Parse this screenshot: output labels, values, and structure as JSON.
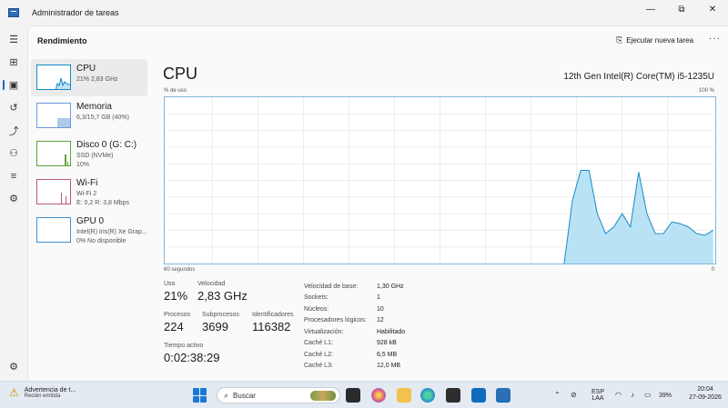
{
  "window": {
    "title": "Administrador de tareas",
    "controls": {
      "minimize": "—",
      "maximize": "⧉",
      "close": "✕"
    }
  },
  "header": {
    "page_title": "Rendimiento",
    "run_task_label": "Ejecutar nueva tarea",
    "more": "···"
  },
  "nav": {
    "items": [
      {
        "icon": "hamburger-icon",
        "glyph": "☰"
      },
      {
        "icon": "processes-icon",
        "glyph": "⊞"
      },
      {
        "icon": "performance-icon",
        "glyph": "▣",
        "active": true
      },
      {
        "icon": "app-history-icon",
        "glyph": "↺"
      },
      {
        "icon": "startup-apps-icon",
        "glyph": "⤴"
      },
      {
        "icon": "users-icon",
        "glyph": "⚇"
      },
      {
        "icon": "details-icon",
        "glyph": "≡"
      },
      {
        "icon": "services-icon",
        "glyph": "⚙"
      }
    ],
    "settings_glyph": "⚙"
  },
  "perf_list": [
    {
      "name": "CPU",
      "lines": [
        "21% 2,83 GHz"
      ],
      "selected": true,
      "color": "#1589c8"
    },
    {
      "name": "Memoria",
      "lines": [
        "6,3/15,7 GB (40%)"
      ],
      "color": "#6b9bd8"
    },
    {
      "name": "Disco 0 (G: C:)",
      "lines": [
        "SSD (NVMe)",
        "10%"
      ],
      "color": "#5ea43a"
    },
    {
      "name": "Wi-Fi",
      "lines": [
        "Wi-Fi 2",
        "E: 0,2 R: 3,8 Mbps"
      ],
      "color": "#b8587a"
    },
    {
      "name": "GPU 0",
      "lines": [
        "Intel(R) Iris(R) Xe Grap...",
        "0% No disponible"
      ],
      "color": "#3f8fd0"
    }
  ],
  "cpu": {
    "title": "CPU",
    "model": "12th Gen Intel(R) Core(TM) i5-1235U",
    "axis_y_label": "% de uso",
    "axis_y_max": "100 %",
    "axis_x_label": "60 segundos",
    "axis_x_min": "0",
    "graph_color": "#1589c8",
    "graph_fill": "#b9e3f5",
    "usage_series": [
      0,
      0,
      0,
      0,
      0,
      0,
      0,
      0,
      0,
      0,
      0,
      0,
      0,
      0,
      0,
      0,
      0,
      0,
      0,
      0,
      0,
      0,
      0,
      0,
      0,
      0,
      0,
      0,
      0,
      0,
      0,
      0,
      0,
      0,
      0,
      0,
      0,
      0,
      0,
      0,
      0,
      0,
      0,
      0,
      0,
      0,
      0,
      0,
      0,
      38,
      56,
      56,
      30,
      18,
      22,
      30,
      22,
      55,
      30,
      18,
      18,
      25,
      24,
      22,
      18,
      17,
      20
    ]
  },
  "stats": {
    "uso_label": "Uso",
    "uso_value": "21%",
    "velocidad_label": "Velocidad",
    "velocidad_value": "2,83 GHz",
    "procesos_label": "Procesos",
    "procesos_value": "224",
    "subprocesos_label": "Subprocesos",
    "subprocesos_value": "3699",
    "identificadores_label": "Identificadores",
    "identificadores_value": "116382",
    "tiempo_label": "Tiempo activo",
    "tiempo_value": "0:02:38:29"
  },
  "specs": [
    {
      "label": "Velocidad de base:",
      "value": "1,30 GHz"
    },
    {
      "label": "Sockets:",
      "value": "1"
    },
    {
      "label": "Núcleos:",
      "value": "10"
    },
    {
      "label": "Procesadores lógicos:",
      "value": "12"
    },
    {
      "label": "Virtualización:",
      "value": "Habilitado"
    },
    {
      "label": "Caché L1:",
      "value": "928 kB"
    },
    {
      "label": "Caché L2:",
      "value": "6,5 MB"
    },
    {
      "label": "Caché L3:",
      "value": "12,0 MB"
    }
  ],
  "taskbar": {
    "notification_title": "Advertencia de t...",
    "notification_sub": "Recién emitida",
    "search_label": "Buscar",
    "lang_line1": "ESP",
    "lang_line2": "LAA",
    "battery": "39%",
    "time": "20:04",
    "date": "27-09-2026"
  }
}
